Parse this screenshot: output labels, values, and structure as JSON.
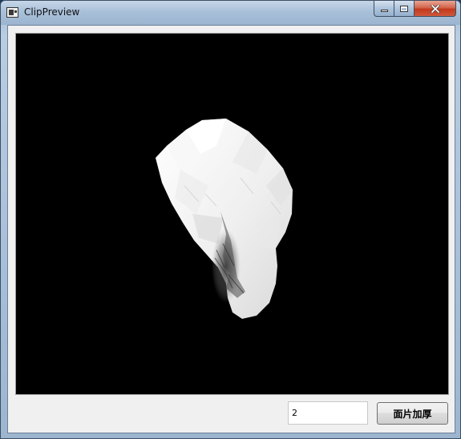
{
  "window": {
    "title": "ClipPreview",
    "app_icon": "window-app-icon",
    "caption_buttons": [
      "minimize-icon",
      "maximize-icon",
      "close-icon"
    ]
  },
  "viewport": {
    "background": "#000000",
    "model_color": "#f4f4f4",
    "model_shade": "#3a3a3a"
  },
  "controls": {
    "thickness_value": "2",
    "thicken_button_label": "面片加厚"
  }
}
